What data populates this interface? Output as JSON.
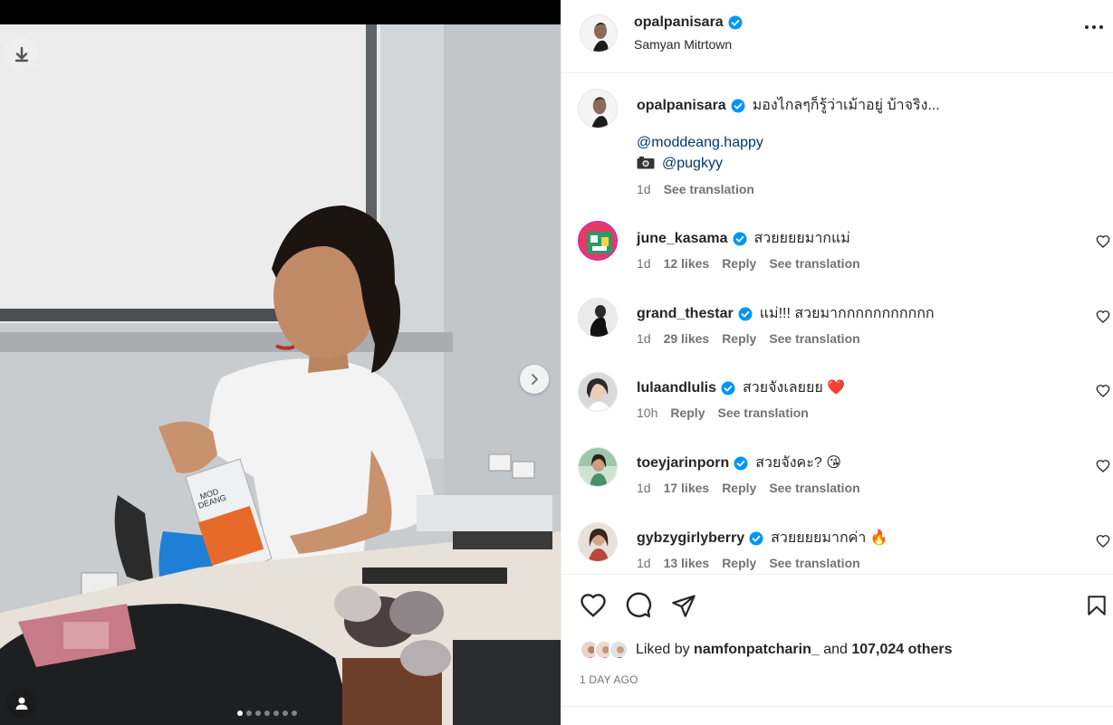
{
  "post": {
    "username": "opalpanisara",
    "location": "Samyan Mitrtown",
    "liked_by_prefix": "Liked by",
    "liked_by_user": "namfonpatcharin_",
    "liked_by_and": "and",
    "liked_by_others": "107,024 others",
    "date": "1 DAY AGO"
  },
  "caption": {
    "username": "opalpanisara",
    "text": "มองไกลๆก็รู้ว่าเม้าอยู่ บ้าจริง...",
    "mention1": "@moddeang.happy",
    "mention2": "@pugkyy",
    "time": "1d",
    "translate": "See translation"
  },
  "comments": [
    {
      "username": "june_kasama",
      "verified": true,
      "text": "สวยยยยมากแม่",
      "time": "1d",
      "likes": "12 likes",
      "reply": "Reply",
      "translate": "See translation"
    },
    {
      "username": "grand_thestar",
      "verified": true,
      "text": "แม่!!! สวยมากกกกกกกกกกก",
      "time": "1d",
      "likes": "29 likes",
      "reply": "Reply",
      "translate": "See translation"
    },
    {
      "username": "lulaandlulis",
      "verified": true,
      "text": "สวยจังเลยยย ❤️",
      "time": "10h",
      "likes": "",
      "reply": "Reply",
      "translate": "See translation"
    },
    {
      "username": "toeyjarinporn",
      "verified": true,
      "text": "สวยจังคะ? 😘",
      "time": "1d",
      "likes": "17 likes",
      "reply": "Reply",
      "translate": "See translation"
    },
    {
      "username": "gybzygirlyberry",
      "verified": true,
      "text": "สวยยยยมากค่า 🔥",
      "time": "1d",
      "likes": "13 likes",
      "reply": "Reply",
      "translate": "See translation"
    }
  ],
  "photo": {
    "package_label1": "MOD",
    "package_label2": "DEANG"
  },
  "carousel": {
    "total": 7,
    "active": 0
  },
  "icons": {
    "download": "download-icon",
    "next": "chevron-right-icon",
    "tag": "user-tag-icon",
    "more": "more-horizontal-icon",
    "like": "heart-icon",
    "comment": "comment-icon",
    "share": "send-icon",
    "save": "bookmark-icon"
  },
  "colors": {
    "verified": "#0095f6",
    "mention": "#00376b",
    "meta": "#737373",
    "heart_red": "#ed4956"
  }
}
